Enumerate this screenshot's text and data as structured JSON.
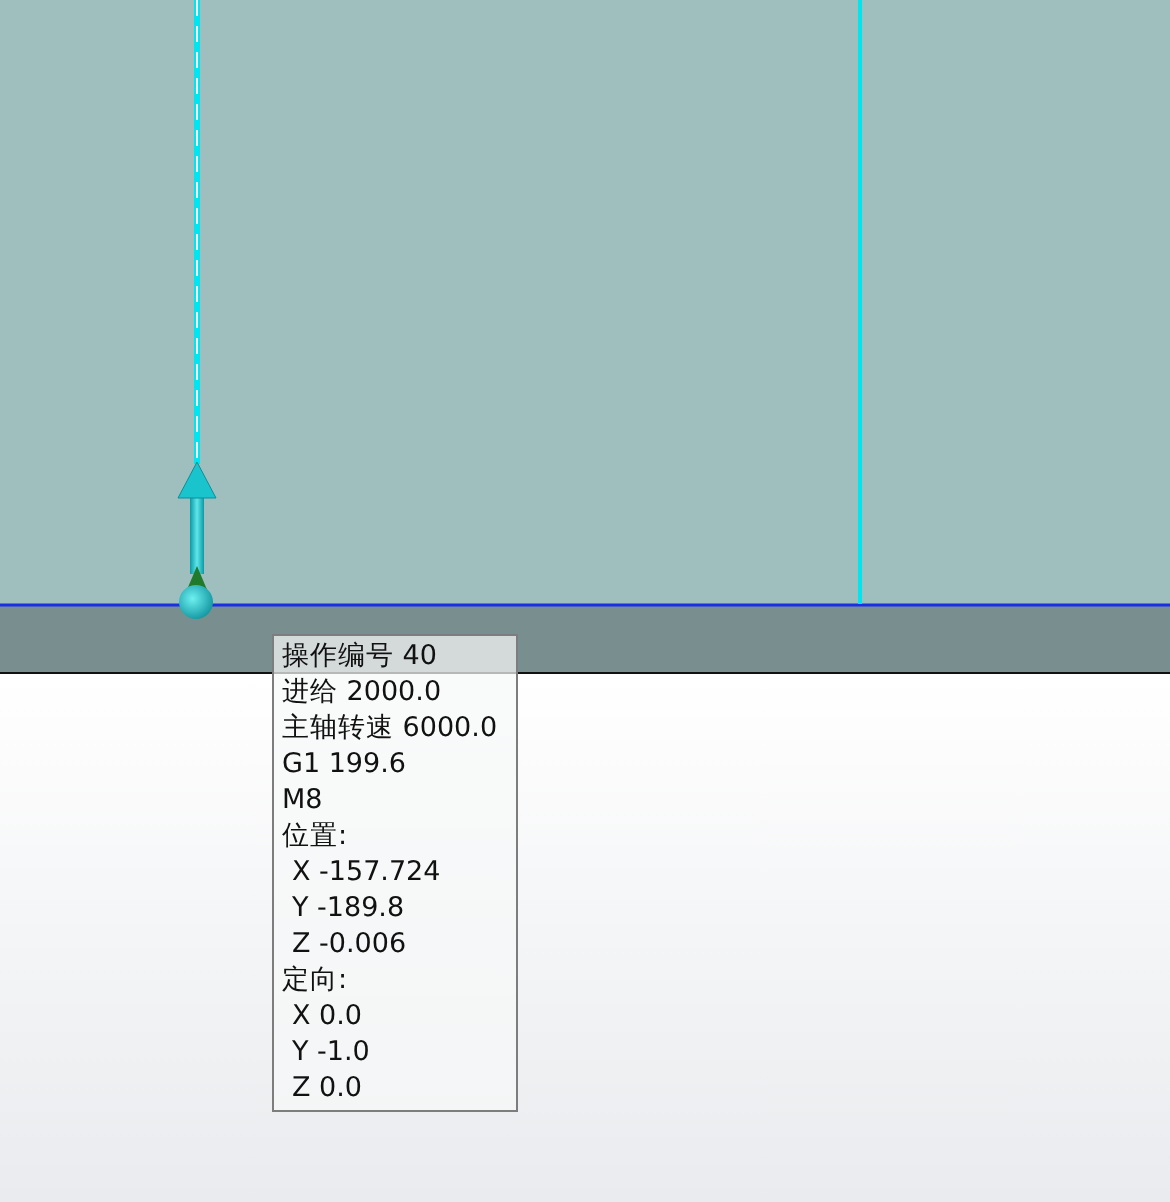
{
  "tooltip": {
    "lines": [
      {
        "text": "操作编号 40",
        "kind": "item"
      },
      {
        "text": "进给 2000.0",
        "kind": "item"
      },
      {
        "text": "主轴转速 6000.0",
        "kind": "item"
      },
      {
        "text": "G1 199.6",
        "kind": "item"
      },
      {
        "text": "M8",
        "kind": "item"
      },
      {
        "text": "位置:",
        "kind": "item"
      },
      {
        "text": "X -157.724",
        "kind": "coord"
      },
      {
        "text": "Y -189.8",
        "kind": "coord"
      },
      {
        "text": "Z -0.006",
        "kind": "coord"
      },
      {
        "text": "定向:",
        "kind": "item"
      },
      {
        "text": "X 0.0",
        "kind": "coord"
      },
      {
        "text": "Y -1.0",
        "kind": "coord"
      },
      {
        "text": "Z 0.0",
        "kind": "coord"
      }
    ]
  }
}
